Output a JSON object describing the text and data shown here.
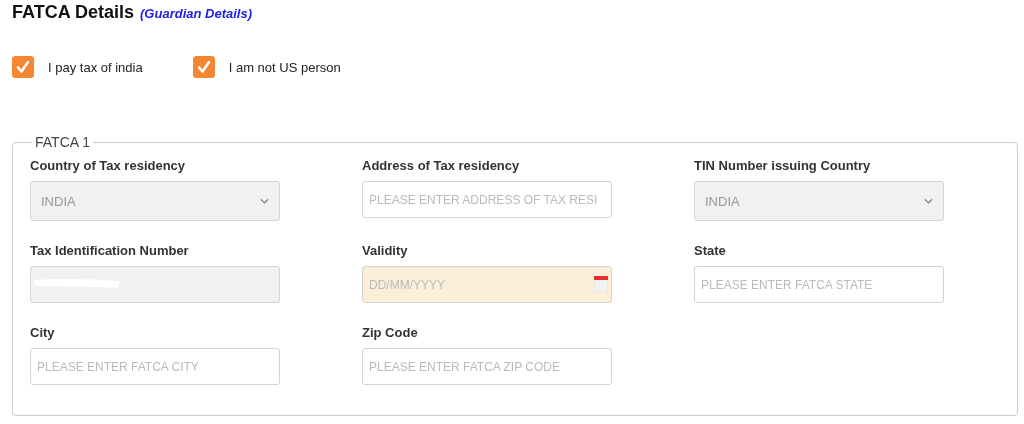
{
  "heading": {
    "title": "FATCA Details",
    "subtitle": "(Guardian Details)"
  },
  "checkboxes": [
    {
      "label": "I pay tax of india",
      "checked": true
    },
    {
      "label": "I am not US person",
      "checked": true
    }
  ],
  "fieldset": {
    "legend": "FATCA 1",
    "fields": [
      {
        "label": "Country of Tax residency",
        "kind": "select",
        "value": "INDIA",
        "disabled": true
      },
      {
        "label": "Address of Tax residency",
        "kind": "text",
        "placeholder": "PLEASE ENTER ADDRESS OF TAX RESI",
        "disabled": false
      },
      {
        "label": "TIN Number issuing Country",
        "kind": "select",
        "value": "INDIA",
        "disabled": true
      },
      {
        "label": "Tax Identification Number",
        "kind": "text",
        "disabled": true,
        "redacted": true
      },
      {
        "label": "Validity",
        "kind": "date",
        "placeholder": "DD/MM/YYYY"
      },
      {
        "label": "State",
        "kind": "text",
        "placeholder": "PLEASE ENTER FATCA STATE",
        "disabled": false
      },
      {
        "label": "City",
        "kind": "text",
        "placeholder": "PLEASE ENTER FATCA CITY",
        "disabled": false
      },
      {
        "label": "Zip Code",
        "kind": "text",
        "placeholder": "PLEASE ENTER FATCA ZIP CODE",
        "disabled": false
      }
    ]
  }
}
